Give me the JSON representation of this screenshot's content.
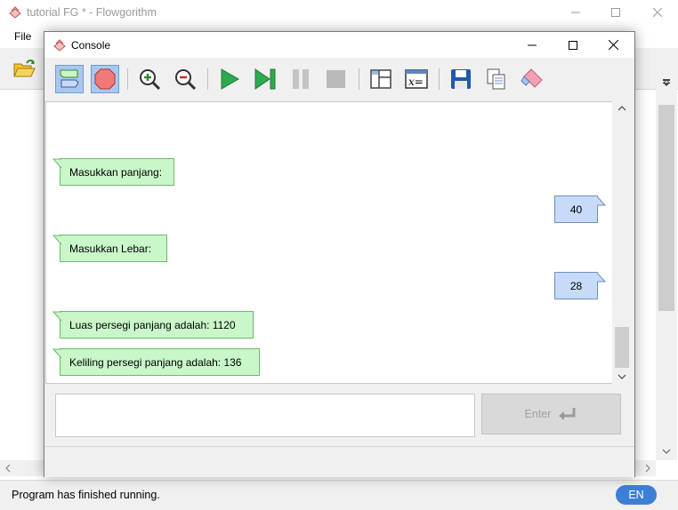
{
  "main_window": {
    "title": "tutorial FG * - Flowgorithm",
    "menu": [
      "File"
    ]
  },
  "console": {
    "title": "Console",
    "output": [
      {
        "dir": "out",
        "text": "Masukkan panjang:"
      },
      {
        "dir": "in",
        "text": "40"
      },
      {
        "dir": "out",
        "text": "Masukkan Lebar:"
      },
      {
        "dir": "in",
        "text": "28"
      },
      {
        "dir": "out",
        "text": "Luas persegi panjang adalah: 1120"
      },
      {
        "dir": "out",
        "text": "Keliling persegi panjang adalah: 136"
      }
    ],
    "input_value": "",
    "enter_label": "Enter",
    "toolbar": [
      "chat-view-icon",
      "stop-sign-icon",
      "zoom-in-icon",
      "zoom-out-icon",
      "run-icon",
      "step-icon",
      "pause-icon",
      "stop-icon",
      "layout-icon",
      "variables-icon",
      "save-icon",
      "copy-icon",
      "clear-icon"
    ]
  },
  "status": {
    "text": "Program has finished running.",
    "language": "EN"
  },
  "colors": {
    "output_bubble": "#c9f7c9",
    "input_bubble": "#c7daf7",
    "language_badge": "#3d7fd6"
  }
}
